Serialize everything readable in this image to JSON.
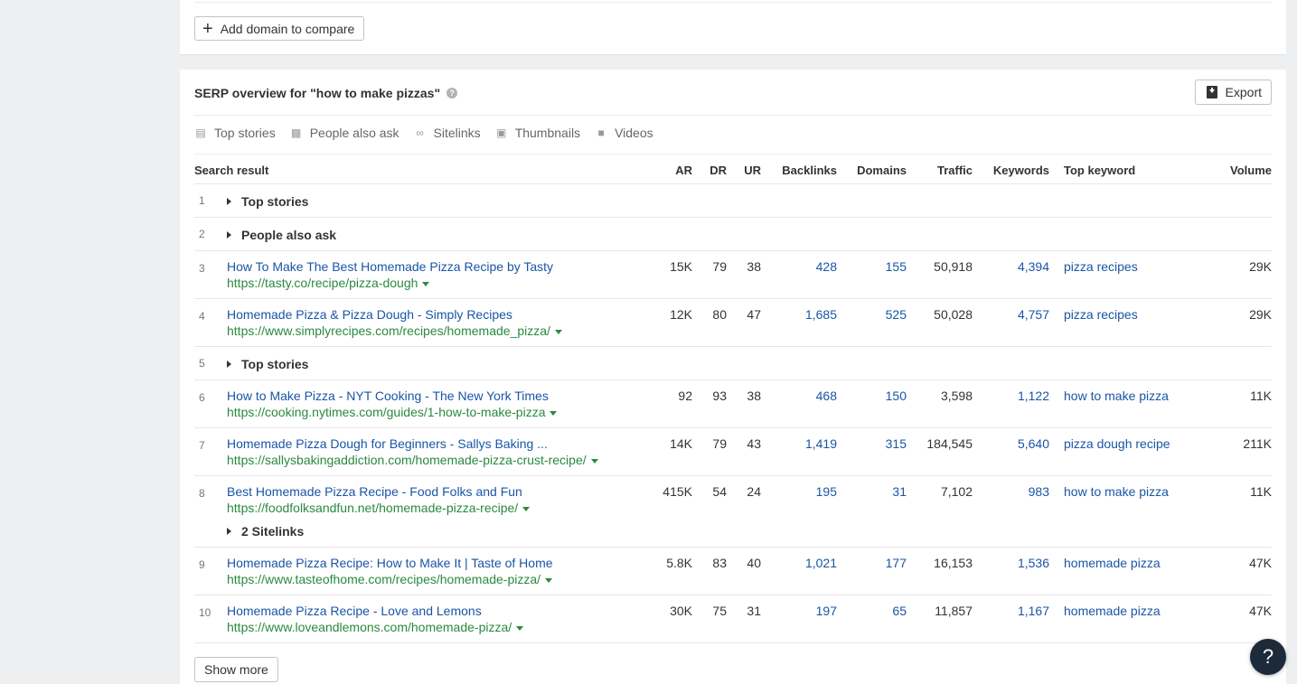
{
  "top_panel": {
    "add_domain_label": "Add domain to compare"
  },
  "serp": {
    "title": "SERP overview for \"how to make pizzas\"",
    "export_label": "Export",
    "features": [
      {
        "icon": "newspaper-icon",
        "label": "Top stories"
      },
      {
        "icon": "chat-icon",
        "label": "People also ask"
      },
      {
        "icon": "link-icon",
        "label": "Sitelinks"
      },
      {
        "icon": "image-icon",
        "label": "Thumbnails"
      },
      {
        "icon": "video-icon",
        "label": "Videos"
      }
    ],
    "columns": {
      "search_result": "Search result",
      "ar": "AR",
      "dr": "DR",
      "ur": "UR",
      "backlinks": "Backlinks",
      "domains": "Domains",
      "traffic": "Traffic",
      "keywords": "Keywords",
      "top_keyword": "Top keyword",
      "volume": "Volume"
    },
    "rows": [
      {
        "rank": "1",
        "feature": "Top stories"
      },
      {
        "rank": "2",
        "feature": "People also ask"
      },
      {
        "rank": "3",
        "title": "How To Make The Best Homemade Pizza Recipe by Tasty",
        "url": "https://tasty.co/recipe/pizza-dough",
        "ar": "15K",
        "dr": "79",
        "ur": "38",
        "backlinks": "428",
        "domains": "155",
        "traffic": "50,918",
        "keywords": "4,394",
        "top_keyword": "pizza recipes",
        "volume": "29K"
      },
      {
        "rank": "4",
        "title": "Homemade Pizza & Pizza Dough - Simply Recipes",
        "url": "https://www.simplyrecipes.com/recipes/homemade_pizza/",
        "ar": "12K",
        "dr": "80",
        "ur": "47",
        "backlinks": "1,685",
        "domains": "525",
        "traffic": "50,028",
        "keywords": "4,757",
        "top_keyword": "pizza recipes",
        "volume": "29K"
      },
      {
        "rank": "5",
        "feature": "Top stories"
      },
      {
        "rank": "6",
        "title": "How to Make Pizza - NYT Cooking - The New York Times",
        "url": "https://cooking.nytimes.com/guides/1-how-to-make-pizza",
        "ar": "92",
        "dr": "93",
        "ur": "38",
        "backlinks": "468",
        "domains": "150",
        "traffic": "3,598",
        "keywords": "1,122",
        "top_keyword": "how to make pizza",
        "volume": "11K"
      },
      {
        "rank": "7",
        "title": "Homemade Pizza Dough for Beginners - Sallys Baking ...",
        "url": "https://sallysbakingaddiction.com/homemade-pizza-crust-recipe/",
        "ar": "14K",
        "dr": "79",
        "ur": "43",
        "backlinks": "1,419",
        "domains": "315",
        "traffic": "184,545",
        "keywords": "5,640",
        "top_keyword": "pizza dough recipe",
        "volume": "211K"
      },
      {
        "rank": "8",
        "title": "Best Homemade Pizza Recipe - Food Folks and Fun",
        "url": "https://foodfolksandfun.net/homemade-pizza-recipe/",
        "ar": "415K",
        "dr": "54",
        "ur": "24",
        "backlinks": "195",
        "domains": "31",
        "traffic": "7,102",
        "keywords": "983",
        "top_keyword": "how to make pizza",
        "volume": "11K",
        "sitelinks": "2 Sitelinks"
      },
      {
        "rank": "9",
        "title": "Homemade Pizza Recipe: How to Make It | Taste of Home",
        "url": "https://www.tasteofhome.com/recipes/homemade-pizza/",
        "ar": "5.8K",
        "dr": "83",
        "ur": "40",
        "backlinks": "1,021",
        "domains": "177",
        "traffic": "16,153",
        "keywords": "1,536",
        "top_keyword": "homemade pizza",
        "volume": "47K"
      },
      {
        "rank": "10",
        "title": "Homemade Pizza Recipe - Love and Lemons",
        "url": "https://www.loveandlemons.com/homemade-pizza/",
        "ar": "30K",
        "dr": "75",
        "ur": "31",
        "backlinks": "197",
        "domains": "65",
        "traffic": "11,857",
        "keywords": "1,167",
        "top_keyword": "homemade pizza",
        "volume": "47K"
      }
    ],
    "show_more_label": "Show more"
  },
  "help_bubble": "?"
}
